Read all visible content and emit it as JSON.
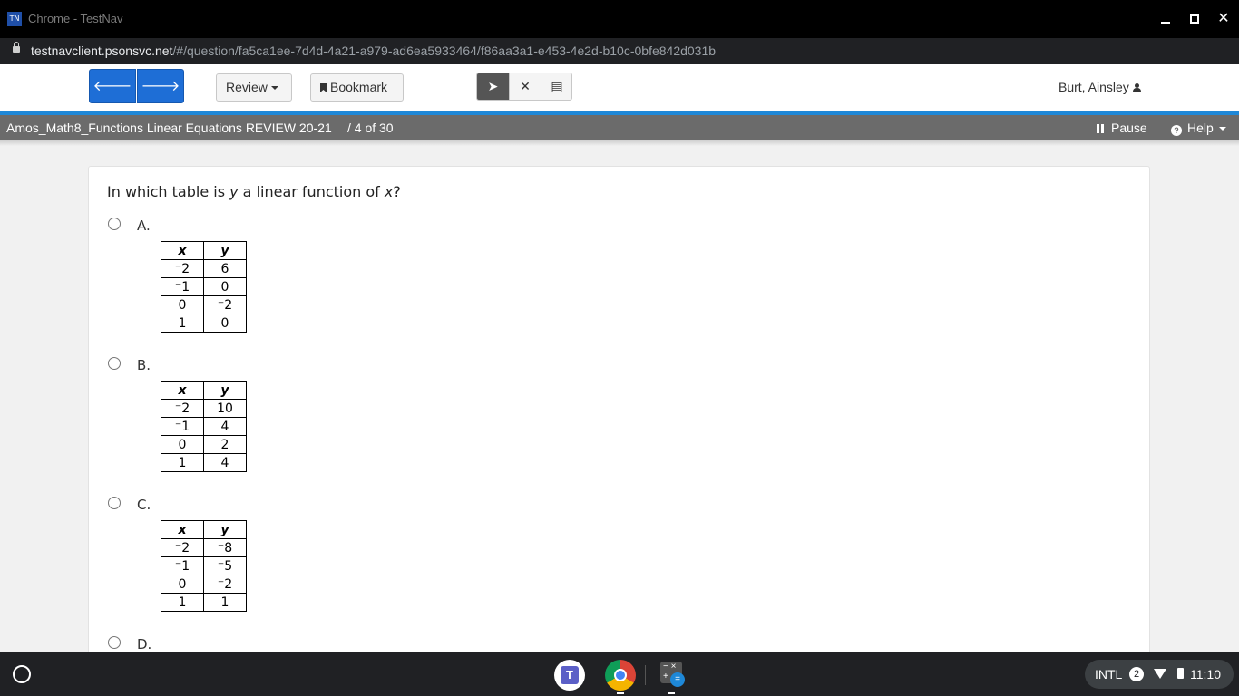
{
  "window": {
    "logo_text": "TN",
    "title": "Chrome - TestNav"
  },
  "address": {
    "host": "testnavclient.psonsvc.net",
    "path": "/#/question/fa5ca1ee-7d4d-4a21-a979-ad6ea5933464/f86aa3a1-e453-4e2d-b10c-0bfe842d031b"
  },
  "toolbar": {
    "prev_icon": "arrow-left-icon",
    "next_icon": "arrow-right-icon",
    "review_label": "Review",
    "bookmark_label": "Bookmark",
    "tools": [
      "pointer-icon",
      "answer-eliminator-icon",
      "notepad-icon"
    ],
    "user_name": "Burt, Ainsley"
  },
  "testbar": {
    "test_name": "Amos_Math8_Functions Linear Equations REVIEW 20-21",
    "position": "/  4 of 30",
    "pause_label": "Pause",
    "help_label": "Help"
  },
  "question": {
    "prefix": "In which table is ",
    "var_y": "y",
    "middle": " a linear function of ",
    "var_x": "x",
    "suffix": "?",
    "options": [
      {
        "label": "A.",
        "header": [
          "x",
          "y"
        ],
        "rows": [
          [
            "⁻2",
            "6"
          ],
          [
            "⁻1",
            "0"
          ],
          [
            "0",
            "⁻2"
          ],
          [
            "1",
            "0"
          ]
        ]
      },
      {
        "label": "B.",
        "header": [
          "x",
          "y"
        ],
        "rows": [
          [
            "⁻2",
            "10"
          ],
          [
            "⁻1",
            "4"
          ],
          [
            "0",
            "2"
          ],
          [
            "1",
            "4"
          ]
        ]
      },
      {
        "label": "C.",
        "header": [
          "x",
          "y"
        ],
        "rows": [
          [
            "⁻2",
            "⁻8"
          ],
          [
            "⁻1",
            "⁻5"
          ],
          [
            "0",
            "⁻2"
          ],
          [
            "1",
            "1"
          ]
        ]
      },
      {
        "label": "D."
      }
    ]
  },
  "shelf": {
    "teams_letter": "T",
    "calc_symbols": "− ×\n+ =",
    "keyboard": "INTL",
    "notifications": "2",
    "time": "11:10"
  },
  "colors": {
    "accent": "#1e6ed6",
    "testbar": "#6b6b6b",
    "divider": "#1e88d8"
  }
}
